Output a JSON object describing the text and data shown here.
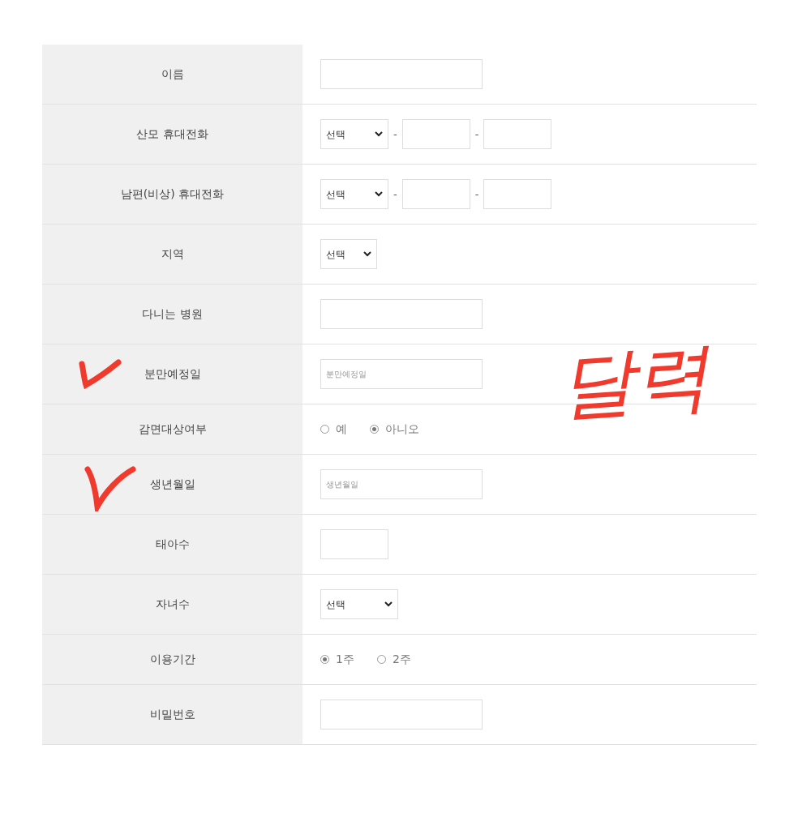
{
  "form_rows": [
    {
      "label": "이름",
      "kind": "text",
      "check_mark": false
    },
    {
      "label": "산모 휴대전화",
      "kind": "phone",
      "select_value": "선택",
      "separators": [
        "-",
        "-"
      ],
      "check_mark": false
    },
    {
      "label": "남편(비상) 휴대전화",
      "kind": "phone",
      "select_value": "선택",
      "separators": [
        "-",
        "-"
      ],
      "check_mark": false
    },
    {
      "label": "지역",
      "kind": "select",
      "select_value": "선택",
      "check_mark": false
    },
    {
      "label": "다니는 병원",
      "kind": "text",
      "check_mark": false
    },
    {
      "label": "분만예정일",
      "kind": "text",
      "placeholder": "분만예정일",
      "check_mark": true
    },
    {
      "label": "감면대상여부",
      "kind": "radio",
      "options": [
        {
          "label": "예",
          "selected": false
        },
        {
          "label": "아니오",
          "selected": true
        }
      ],
      "check_mark": false
    },
    {
      "label": "생년월일",
      "kind": "text",
      "placeholder": "생년월일",
      "check_mark": true
    },
    {
      "label": "태아수",
      "kind": "number",
      "check_mark": false
    },
    {
      "label": "자녀수",
      "kind": "select",
      "select_value": "선택",
      "check_mark": false
    },
    {
      "label": "이용기간",
      "kind": "radio",
      "options": [
        {
          "label": "1주",
          "selected": true
        },
        {
          "label": "2주",
          "selected": false
        }
      ],
      "check_mark": false
    },
    {
      "label": "비밀번호",
      "kind": "text",
      "check_mark": false
    }
  ],
  "annotation": {
    "text": "달력"
  }
}
